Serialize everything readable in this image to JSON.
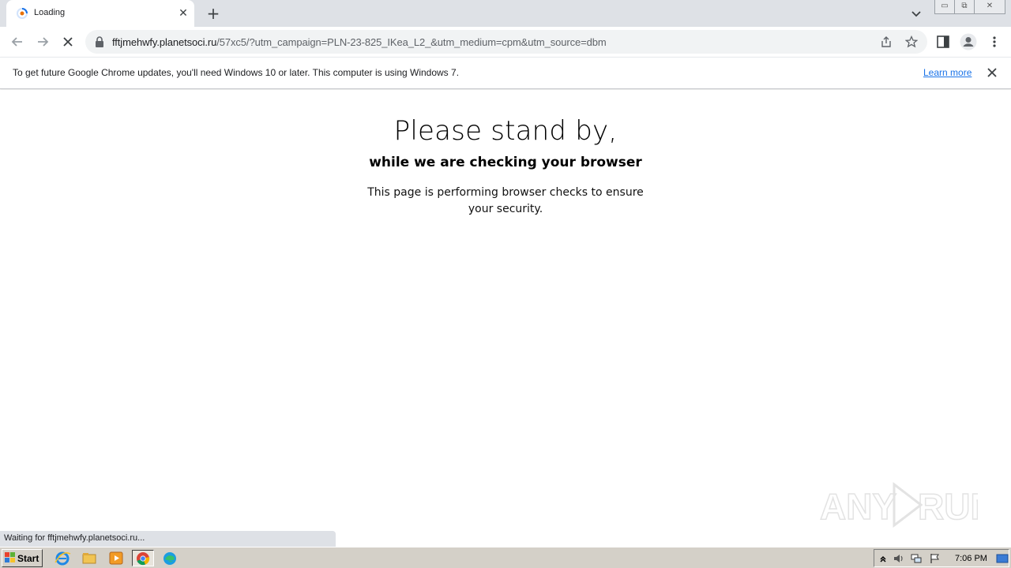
{
  "browser": {
    "tab": {
      "title": "Loading"
    },
    "omnibox": {
      "url_host": "fftjmehwfy.planetsoci.ru",
      "url_path": "/57xc5/?utm_campaign=PLN-23-825_IKea_L2_&utm_medium=cpm&utm_source=dbm"
    },
    "infobar": {
      "message": "To get future Google Chrome updates, you'll need Windows 10 or later. This computer is using Windows 7.",
      "link": "Learn more"
    },
    "status": "Waiting for fftjmehwfy.planetsoci.ru..."
  },
  "page": {
    "heading": "Please stand by,",
    "subheading": "while we are checking your browser",
    "description": "This page is performing browser checks to ensure your security."
  },
  "watermark": {
    "text": "ANY RUN"
  },
  "taskbar": {
    "start_label": "Start",
    "clock": "7:06 PM",
    "apps": [
      "internet-explorer-icon",
      "file-explorer-icon",
      "media-player-icon",
      "chrome-icon",
      "edge-icon"
    ]
  },
  "colors": {
    "tabstrip": "#dee1e6",
    "link": "#1a73e8",
    "taskbar": "#d4d0c8"
  }
}
